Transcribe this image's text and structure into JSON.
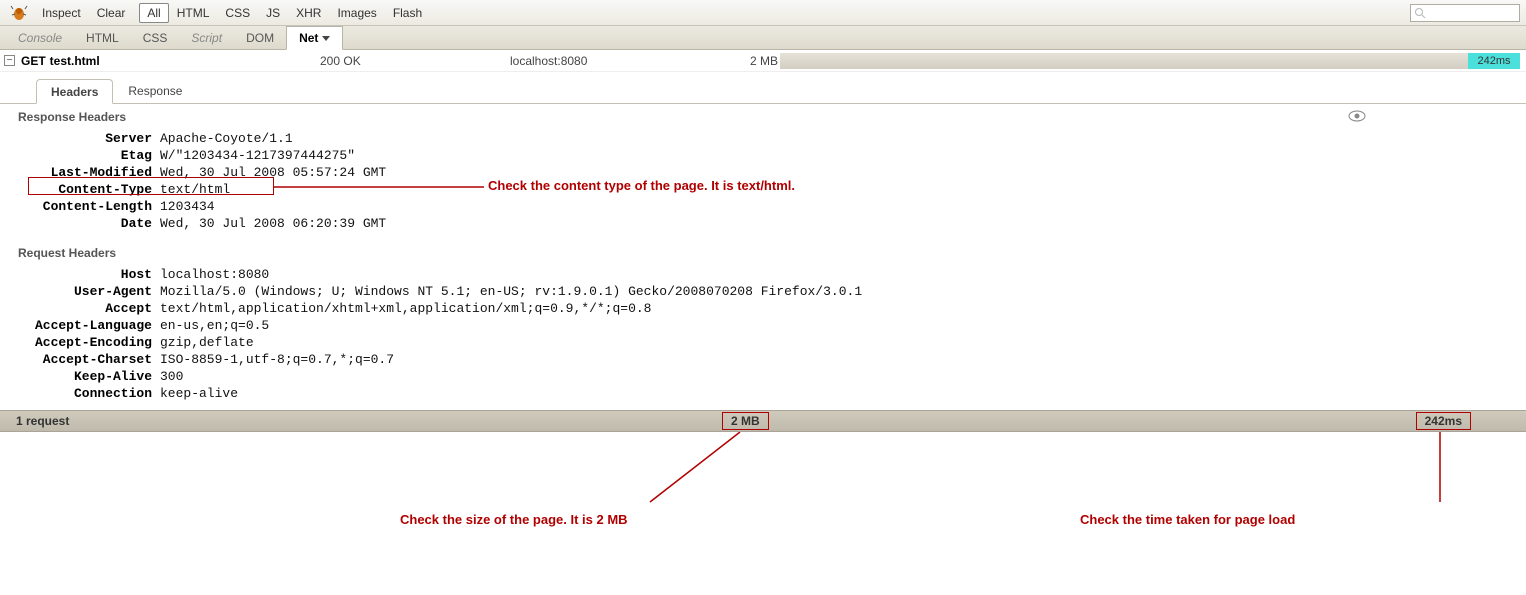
{
  "toolbar": {
    "inspect": "Inspect",
    "clear": "Clear",
    "filters": [
      "All",
      "HTML",
      "CSS",
      "JS",
      "XHR",
      "Images",
      "Flash"
    ],
    "active_filter": "All"
  },
  "panels": {
    "items": [
      "Console",
      "HTML",
      "CSS",
      "Script",
      "DOM",
      "Net"
    ],
    "active": "Net"
  },
  "request": {
    "toggle": "−",
    "method": "GET",
    "url": "test.html",
    "status": "200 OK",
    "domain": "localhost:8080",
    "size": "2 MB",
    "time": "242ms"
  },
  "detail_tabs": {
    "headers": "Headers",
    "response": "Response"
  },
  "sections": {
    "response_headers": "Response Headers",
    "request_headers": "Request Headers"
  },
  "response_headers": [
    {
      "name": "Server",
      "value": "Apache-Coyote/1.1"
    },
    {
      "name": "Etag",
      "value": "W/\"1203434-1217397444275\""
    },
    {
      "name": "Last-Modified",
      "value": "Wed, 30 Jul 2008 05:57:24 GMT"
    },
    {
      "name": "Content-Type",
      "value": "text/html"
    },
    {
      "name": "Content-Length",
      "value": "1203434"
    },
    {
      "name": "Date",
      "value": "Wed, 30 Jul 2008 06:20:39 GMT"
    }
  ],
  "request_headers": [
    {
      "name": "Host",
      "value": "localhost:8080"
    },
    {
      "name": "User-Agent",
      "value": "Mozilla/5.0 (Windows; U; Windows NT 5.1; en-US; rv:1.9.0.1) Gecko/2008070208 Firefox/3.0.1"
    },
    {
      "name": "Accept",
      "value": "text/html,application/xhtml+xml,application/xml;q=0.9,*/*;q=0.8"
    },
    {
      "name": "Accept-Language",
      "value": "en-us,en;q=0.5"
    },
    {
      "name": "Accept-Encoding",
      "value": "gzip,deflate"
    },
    {
      "name": "Accept-Charset",
      "value": "ISO-8859-1,utf-8;q=0.7,*;q=0.7"
    },
    {
      "name": "Keep-Alive",
      "value": "300"
    },
    {
      "name": "Connection",
      "value": "keep-alive"
    }
  ],
  "summary": {
    "requests": "1 request",
    "size": "2 MB",
    "time": "242ms"
  },
  "annotations": {
    "content_type": "Check the content type of the page. It is text/html.",
    "size": "Check the size of the page. It is 2 MB",
    "time": "Check the time taken for page load"
  }
}
